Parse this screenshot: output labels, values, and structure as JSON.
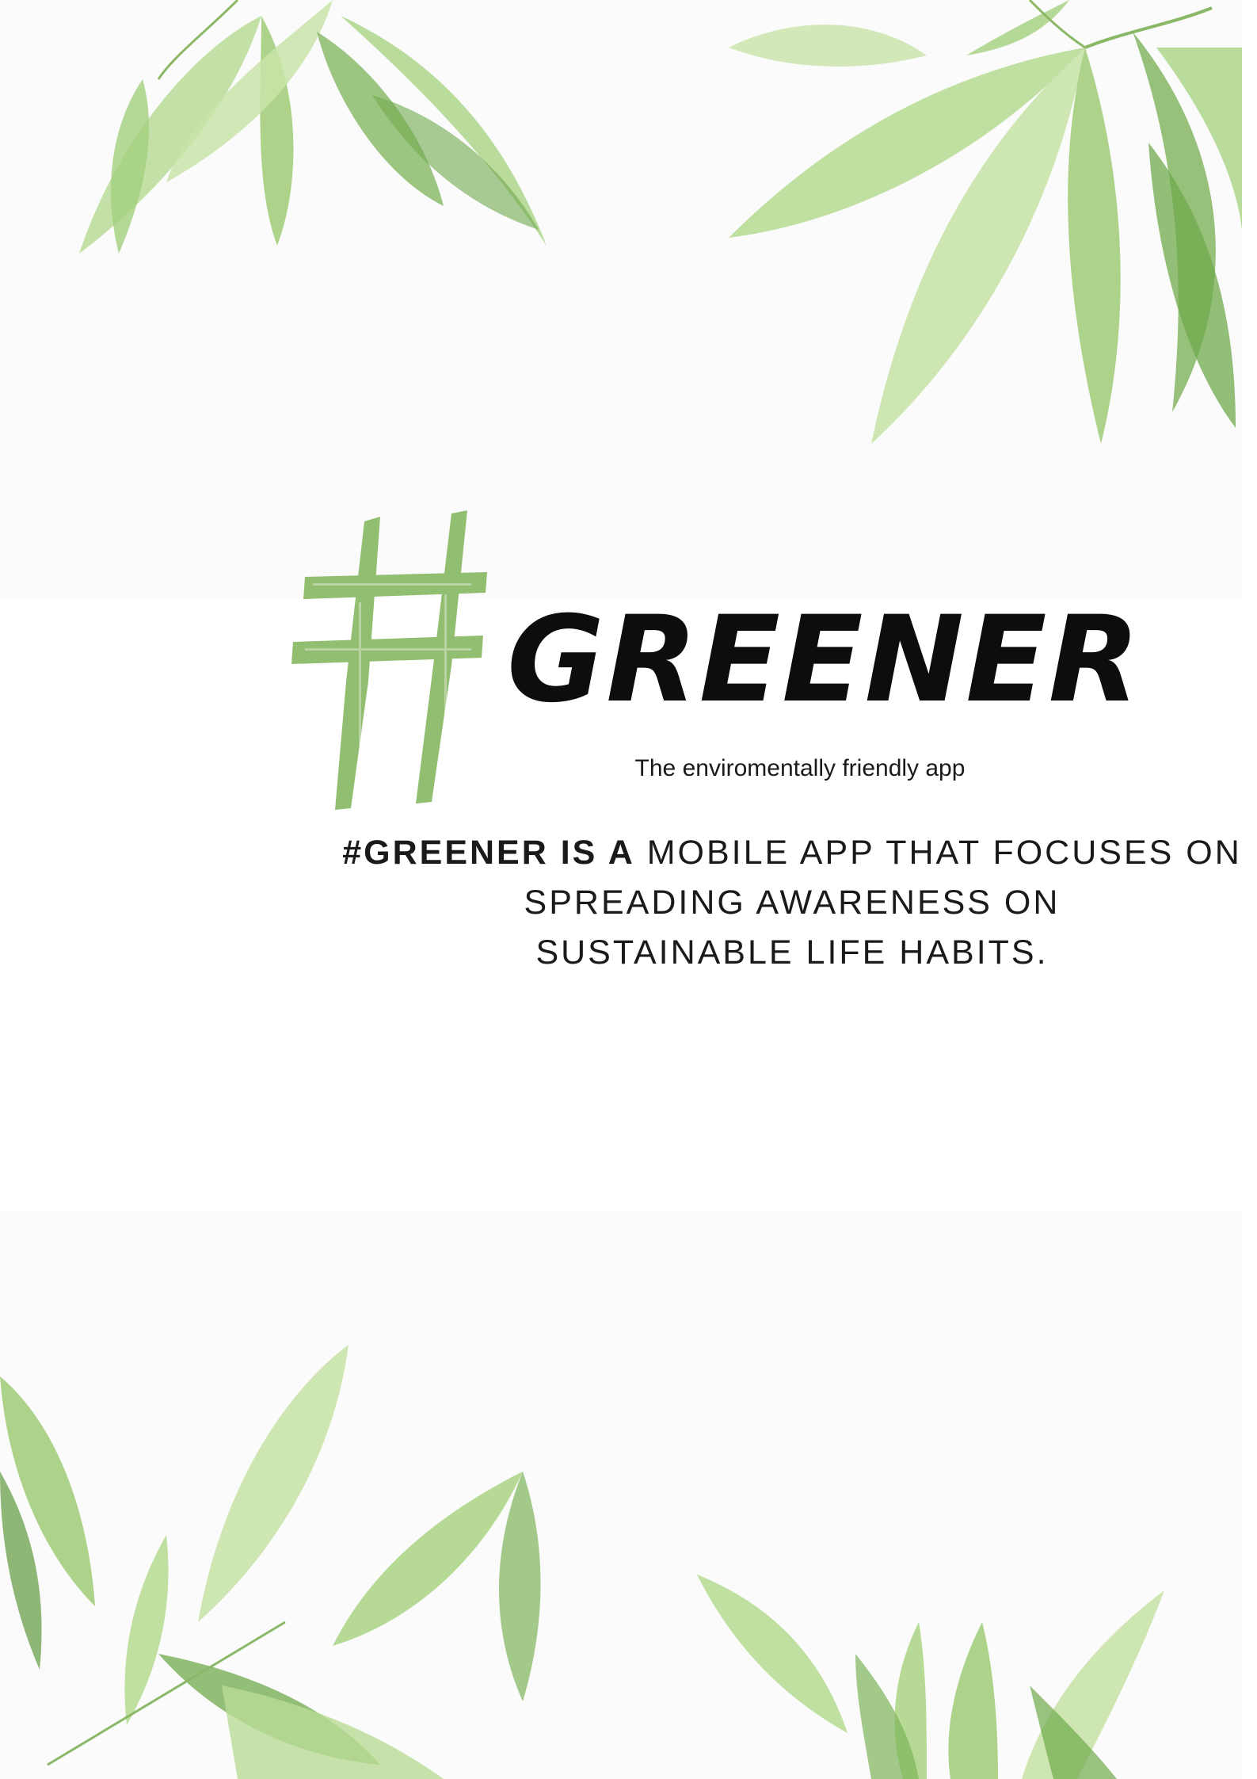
{
  "brand": {
    "hash_symbol": "#",
    "title": "GREENER",
    "tagline": "The enviromentally  friendly app"
  },
  "description": {
    "lead": "#GREENER IS A",
    "line1_rest": " MOBILE APP THAT FOCUSES ON",
    "line2": "SPREADING AWARENESS ON",
    "line3": "SUSTAINABLE LIFE HABITS."
  },
  "decor": {
    "top_image": "green-leaves-photo",
    "bottom_image": "green-leaves-photo",
    "hash_icon": "brush-hashtag-icon"
  },
  "colors": {
    "background": "#ffffff",
    "hash_green": "#8cbb6a",
    "leaf_light": "#c9e3a8",
    "leaf_mid": "#9fcb77",
    "leaf_dark": "#6fa94c",
    "text": "#0d0d0d"
  }
}
